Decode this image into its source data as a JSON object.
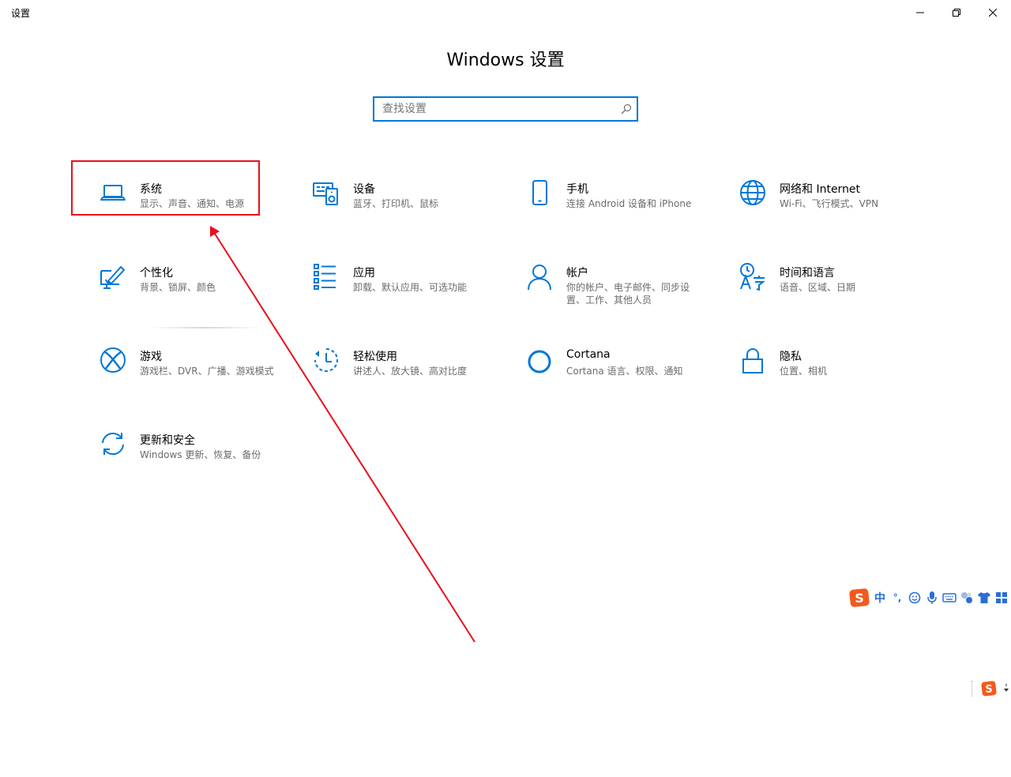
{
  "window": {
    "title": "设置",
    "minimize_icon": "minimize-icon",
    "restore_icon": "restore-icon",
    "close_icon": "close-icon"
  },
  "page": {
    "title": "Windows 设置"
  },
  "search": {
    "placeholder": "查找设置",
    "value": ""
  },
  "categories": [
    {
      "name": "系统",
      "desc": "显示、声音、通知、电源",
      "icon": "laptop-icon"
    },
    {
      "name": "设备",
      "desc": "蓝牙、打印机、鼠标",
      "icon": "devices-icon"
    },
    {
      "name": "手机",
      "desc": "连接 Android 设备和 iPhone",
      "icon": "phone-icon"
    },
    {
      "name": "网络和 Internet",
      "desc": "Wi-Fi、飞行模式、VPN",
      "icon": "globe-icon"
    },
    {
      "name": "个性化",
      "desc": "背景、锁屏、颜色",
      "icon": "personalization-icon"
    },
    {
      "name": "应用",
      "desc": "卸载、默认应用、可选功能",
      "icon": "apps-list-icon"
    },
    {
      "name": "帐户",
      "desc": "你的帐户、电子邮件、同步设置、工作、其他人员",
      "icon": "person-icon"
    },
    {
      "name": "时间和语言",
      "desc": "语音、区域、日期",
      "icon": "time-language-icon"
    },
    {
      "name": "游戏",
      "desc": "游戏栏、DVR、广播、游戏模式",
      "icon": "xbox-icon"
    },
    {
      "name": "轻松使用",
      "desc": "讲述人、放大镜、高对比度",
      "icon": "ease-of-access-icon"
    },
    {
      "name": "Cortana",
      "desc": "Cortana 语言、权限、通知",
      "icon": "cortana-icon"
    },
    {
      "name": "隐私",
      "desc": "位置、相机",
      "icon": "lock-icon"
    },
    {
      "name": "更新和安全",
      "desc": "Windows 更新、恢复、备份",
      "icon": "update-icon"
    }
  ],
  "ime_toolbar": {
    "logo": "sogou-logo-icon",
    "language_label": "中",
    "punctuation_label": "°,",
    "icons": [
      "emoji-icon",
      "microphone-icon",
      "keyboard-icon",
      "tools-icon",
      "skin-icon",
      "grid-icon"
    ]
  },
  "colors": {
    "accent": "#0078d7",
    "annotation_red": "#e8101c",
    "ime_blue": "#2a6ed6",
    "ime_orange": "#f25a1e"
  }
}
